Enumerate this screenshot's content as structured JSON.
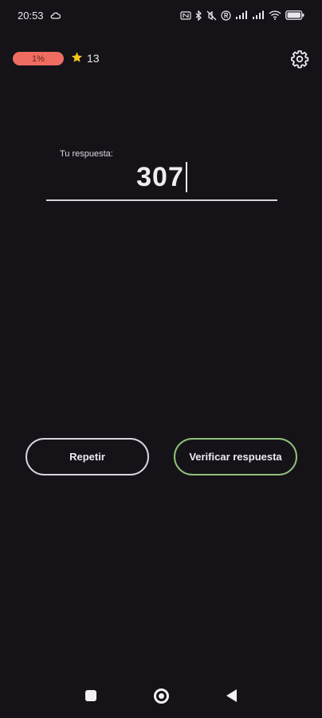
{
  "status_bar": {
    "time": "20:53",
    "battery": "88"
  },
  "top_bar": {
    "progress_text": "1%",
    "progress_value": 0.01,
    "star_count": "13"
  },
  "answer": {
    "label": "Tu respuesta:",
    "value": "307"
  },
  "buttons": {
    "repeat_label": "Repetir",
    "verify_label": "Verificar respuesta"
  },
  "colors": {
    "background": "#151318",
    "progress": "#ef6c61",
    "verify_border": "#8fc27a",
    "star": "#f5c518"
  },
  "icons": [
    "cloud-icon",
    "star-icon",
    "gear-icon",
    "bluetooth-icon",
    "wifi-icon",
    "battery-icon"
  ]
}
